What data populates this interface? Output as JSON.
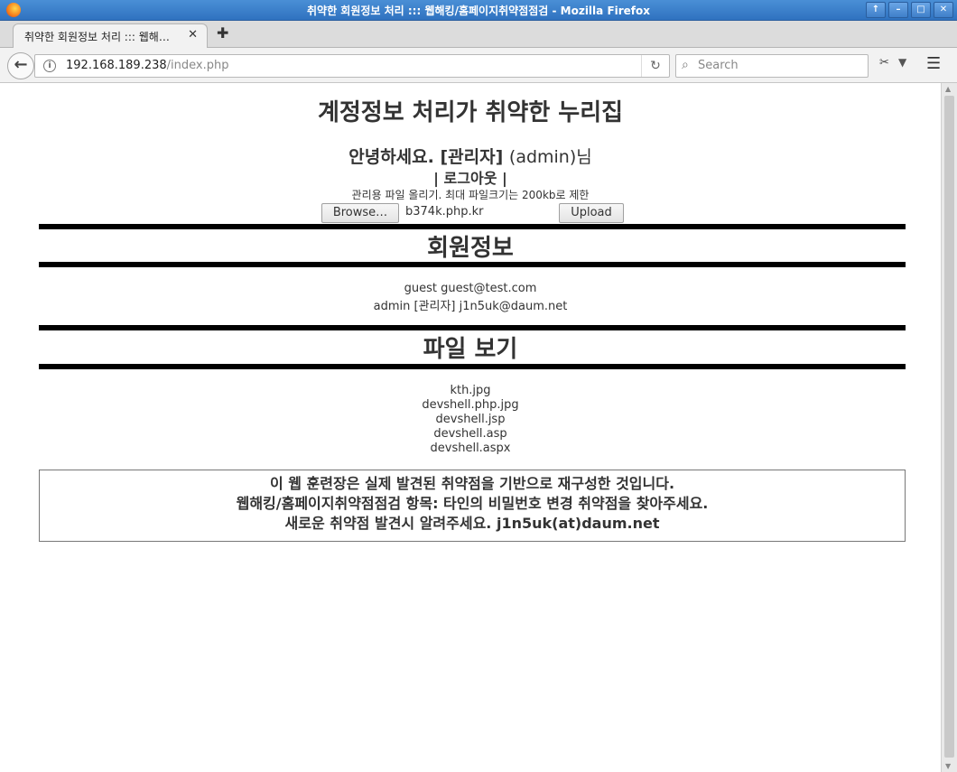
{
  "window": {
    "title": "취약한 회원정보 처리 ::: 웹해킹/홈페이지취약점점검 - Mozilla Firefox",
    "buttons": [
      "↑",
      "–",
      "□",
      "✕"
    ]
  },
  "tab": {
    "label": "취약한 회원정보 처리 ::: 웹해…",
    "close": "✕",
    "new_tab": "✚"
  },
  "nav": {
    "back": "←",
    "info": "i",
    "url_host": "192.168.189.238",
    "url_path": "/index.php",
    "reload": "↻",
    "search_placeholder": "Search",
    "search_icon": "⌕",
    "addon": "✂",
    "dropdown": "▼",
    "menu": "☰"
  },
  "page": {
    "title": "계정정보 처리가 취약한 누리집",
    "greeting_prefix": "안녕하세요. [관리자]",
    "greeting_id": "(admin)",
    "greeting_suffix": "님",
    "logout": "| 로그아웃 |",
    "upload_label": "관리용 파일 올리기. 최대 파일크기는 200kb로 제한",
    "browse_button": "Browse…",
    "selected_file": "b374k.php.kr",
    "upload_button": "Upload"
  },
  "members": {
    "title": "회원정보",
    "rows": [
      "guest guest@test.com",
      "admin [관리자] j1n5uk@daum.net"
    ]
  },
  "files": {
    "title": "파일 보기",
    "items": [
      "kth.jpg",
      "devshell.php.jpg",
      "devshell.jsp",
      "devshell.asp",
      "devshell.aspx"
    ]
  },
  "notice": {
    "lines": [
      "이 웹 훈련장은 실제 발견된 취약점을 기반으로 재구성한 것입니다.",
      "웹해킹/홈페이지취약점점검 항목: 타인의 비밀번호 변경 취약점을 찾아주세요.",
      "새로운 취약점 발견시 알려주세요. j1n5uk(at)daum.net"
    ]
  },
  "scrollbar": {
    "up": "▲",
    "down": "▼"
  },
  "colors": {
    "titlebar": "#2f72c0",
    "rule": "#000000"
  }
}
